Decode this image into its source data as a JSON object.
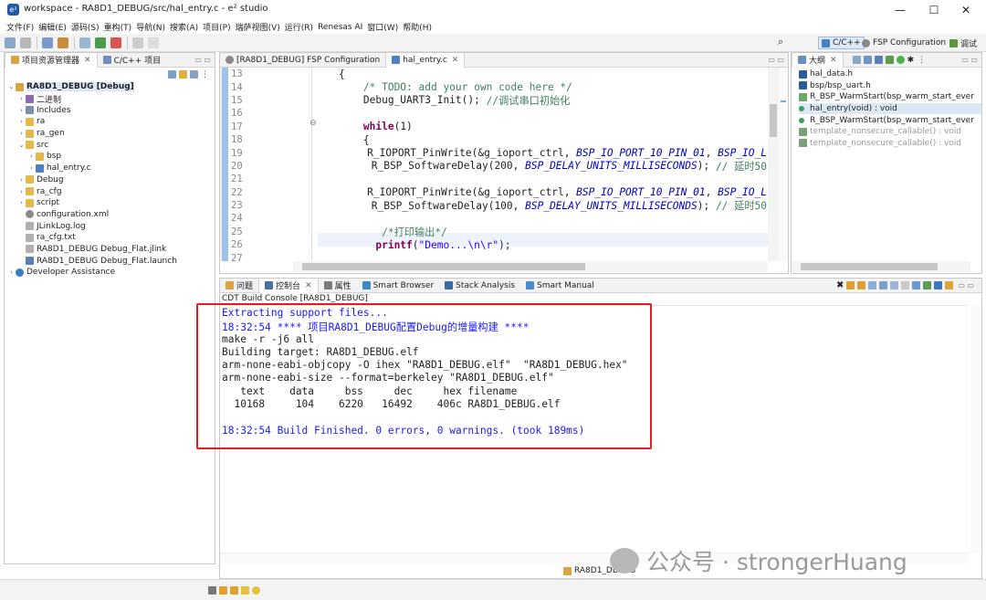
{
  "window": {
    "title": "workspace - RA8D1_DEBUG/src/hal_entry.c - e² studio",
    "minimize": "—",
    "maximize": "☐",
    "close": "✕"
  },
  "menu": [
    "文件(F)",
    "编辑(E)",
    "源码(S)",
    "重构(T)",
    "导航(N)",
    "搜索(A)",
    "项目(P)",
    "瑞萨视图(V)",
    "运行(R)",
    "Renesas AI",
    "窗口(W)",
    "帮助(H)"
  ],
  "perspectives": {
    "cpp": "C/C++",
    "fsp": "FSP Configuration",
    "debug": "调试"
  },
  "explorer": {
    "tabs": [
      "项目资源管理器",
      "C/C++ 项目"
    ],
    "items": [
      {
        "label": "RA8D1_DEBUG [Debug]",
        "indent": 0,
        "arrow": "v",
        "icon": "project-icon",
        "bold": true
      },
      {
        "label": "二进制",
        "indent": 1,
        "arrow": ">",
        "icon": "binaries-icon"
      },
      {
        "label": "Includes",
        "indent": 1,
        "arrow": ">",
        "icon": "includes-icon"
      },
      {
        "label": "ra",
        "indent": 1,
        "arrow": ">",
        "icon": "folder-icon"
      },
      {
        "label": "ra_gen",
        "indent": 1,
        "arrow": ">",
        "icon": "folder-icon"
      },
      {
        "label": "src",
        "indent": 1,
        "arrow": "v",
        "icon": "folder-icon"
      },
      {
        "label": "bsp",
        "indent": 2,
        "arrow": ">",
        "icon": "folder-icon"
      },
      {
        "label": "hal_entry.c",
        "indent": 2,
        "arrow": ">",
        "icon": "c-file-icon"
      },
      {
        "label": "Debug",
        "indent": 1,
        "arrow": ">",
        "icon": "folder-icon"
      },
      {
        "label": "ra_cfg",
        "indent": 1,
        "arrow": ">",
        "icon": "folder-icon"
      },
      {
        "label": "script",
        "indent": 1,
        "arrow": ">",
        "icon": "folder-icon"
      },
      {
        "label": "configuration.xml",
        "indent": 1,
        "arrow": "",
        "icon": "gear-icon"
      },
      {
        "label": "JLinkLog.log",
        "indent": 1,
        "arrow": "",
        "icon": "file-icon"
      },
      {
        "label": "ra_cfg.txt",
        "indent": 1,
        "arrow": "",
        "icon": "file-icon"
      },
      {
        "label": "RA8D1_DEBUG Debug_Flat.jlink",
        "indent": 1,
        "arrow": "",
        "icon": "file-icon"
      },
      {
        "label": "RA8D1_DEBUG Debug_Flat.launch",
        "indent": 1,
        "arrow": "",
        "icon": "launch-icon"
      },
      {
        "label": "Developer Assistance",
        "indent": 0,
        "arrow": ">",
        "icon": "help-icon"
      }
    ]
  },
  "editor": {
    "tabs": [
      "[RA8D1_DEBUG] FSP Configuration",
      "hal_entry.c"
    ],
    "line_numbers": [
      "13",
      "14",
      "15",
      "16",
      "17",
      "18",
      "19",
      "20",
      "21",
      "22",
      "23",
      "24",
      "25",
      "26",
      "27"
    ],
    "lines": [
      [
        {
          "t": "    {",
          "c": ""
        }
      ],
      [
        {
          "t": "        ",
          "c": ""
        },
        {
          "t": "/* TODO: add your own code here */",
          "c": "cm"
        }
      ],
      [
        {
          "t": "        Debug_UART3_Init(); ",
          "c": ""
        },
        {
          "t": "//调试串口初始化",
          "c": "cm"
        }
      ],
      [
        {
          "t": "",
          "c": ""
        }
      ],
      [
        {
          "t": "        ",
          "c": ""
        },
        {
          "t": "while",
          "c": "kw"
        },
        {
          "t": "(1)",
          "c": ""
        }
      ],
      [
        {
          "t": "        {",
          "c": ""
        }
      ],
      [
        {
          "t": "            R_IOPORT_PinWrite(&g_ioport_ctrl, ",
          "c": ""
        },
        {
          "t": "BSP_IO_PORT_10_PIN_01",
          "c": "it"
        },
        {
          "t": ", ",
          "c": ""
        },
        {
          "t": "BSP_IO_L",
          "c": "it"
        }
      ],
      [
        {
          "t": "            R_BSP_SoftwareDelay(200, ",
          "c": ""
        },
        {
          "t": "BSP_DELAY_UNITS_MILLISECONDS",
          "c": "it"
        },
        {
          "t": "); ",
          "c": ""
        },
        {
          "t": "// 延时50",
          "c": "cm"
        }
      ],
      [
        {
          "t": "",
          "c": ""
        }
      ],
      [
        {
          "t": "            R_IOPORT_PinWrite(&g_ioport_ctrl, ",
          "c": ""
        },
        {
          "t": "BSP_IO_PORT_10_PIN_01",
          "c": "it"
        },
        {
          "t": ", ",
          "c": ""
        },
        {
          "t": "BSP_IO_L",
          "c": "it"
        }
      ],
      [
        {
          "t": "            R_BSP_SoftwareDelay(100, ",
          "c": ""
        },
        {
          "t": "BSP_DELAY_UNITS_MILLISECONDS",
          "c": "it"
        },
        {
          "t": "); ",
          "c": ""
        },
        {
          "t": "// 延时50",
          "c": "cm"
        }
      ],
      [
        {
          "t": "",
          "c": ""
        }
      ],
      [
        {
          "t": "           ",
          "c": ""
        },
        {
          "t": "/*打印输出*/",
          "c": "cm"
        }
      ],
      [
        {
          "t": "          ",
          "c": ""
        },
        {
          "t": "printf",
          "c": "kw"
        },
        {
          "t": "(",
          "c": ""
        },
        {
          "t": "\"Demo...\\n\\r\"",
          "c": "str"
        },
        {
          "t": ");",
          "c": ""
        }
      ],
      [
        {
          "t": "",
          "c": ""
        }
      ]
    ]
  },
  "outline": {
    "tab": "大纲",
    "items": [
      {
        "label": "hal_data.h",
        "icon": "include-icon",
        "dim": false
      },
      {
        "label": "bsp/bsp_uart.h",
        "icon": "include-icon",
        "dim": false
      },
      {
        "label": "R_BSP_WarmStart(bsp_warm_start_ever",
        "icon": "function-icon",
        "dim": false
      },
      {
        "label": "hal_entry(void) : void",
        "icon": "method-icon",
        "dim": false,
        "selected": true
      },
      {
        "label": "R_BSP_WarmStart(bsp_warm_start_ever",
        "icon": "method-icon",
        "dim": false
      },
      {
        "label": "template_nonsecure_callable() : void",
        "icon": "declaration-icon",
        "dim": true
      },
      {
        "label": "template_nonsecure_callable() : void",
        "icon": "declaration-icon",
        "dim": true
      }
    ]
  },
  "bottom": {
    "tabs": [
      "问题",
      "控制台",
      "属性",
      "Smart Browser",
      "Stack Analysis",
      "Smart Manual"
    ],
    "console_title": "CDT Build Console [RA8D1_DEBUG]",
    "lines": [
      {
        "text": "Extracting support files...",
        "blue": true
      },
      {
        "text": "18:32:54 **** 项目RA8D1_DEBUG配置Debug的增量构建 ****",
        "blue": true
      },
      {
        "text": "make -r -j6 all",
        "blue": false
      },
      {
        "text": "Building target: RA8D1_DEBUG.elf",
        "blue": false
      },
      {
        "text": "arm-none-eabi-objcopy -O ihex \"RA8D1_DEBUG.elf\"  \"RA8D1_DEBUG.hex\"",
        "blue": false
      },
      {
        "text": "arm-none-eabi-size --format=berkeley \"RA8D1_DEBUG.elf\"",
        "blue": false
      },
      {
        "text": "   text    data     bss     dec     hex filename",
        "blue": false
      },
      {
        "text": "  10168     104    6220   16492    406c RA8D1_DEBUG.elf",
        "blue": false
      },
      {
        "text": "",
        "blue": false
      },
      {
        "text": "18:32:54 Build Finished. 0 errors, 0 warnings. (took 189ms)",
        "blue": true
      }
    ]
  },
  "status": {
    "project": "RA8D1_DEBUG"
  },
  "watermark": "公众号 · strongerHuang",
  "colors": {
    "highlight_box": "#e02020",
    "accent": "#1e5aa8",
    "selection": "#cfe3f7"
  }
}
